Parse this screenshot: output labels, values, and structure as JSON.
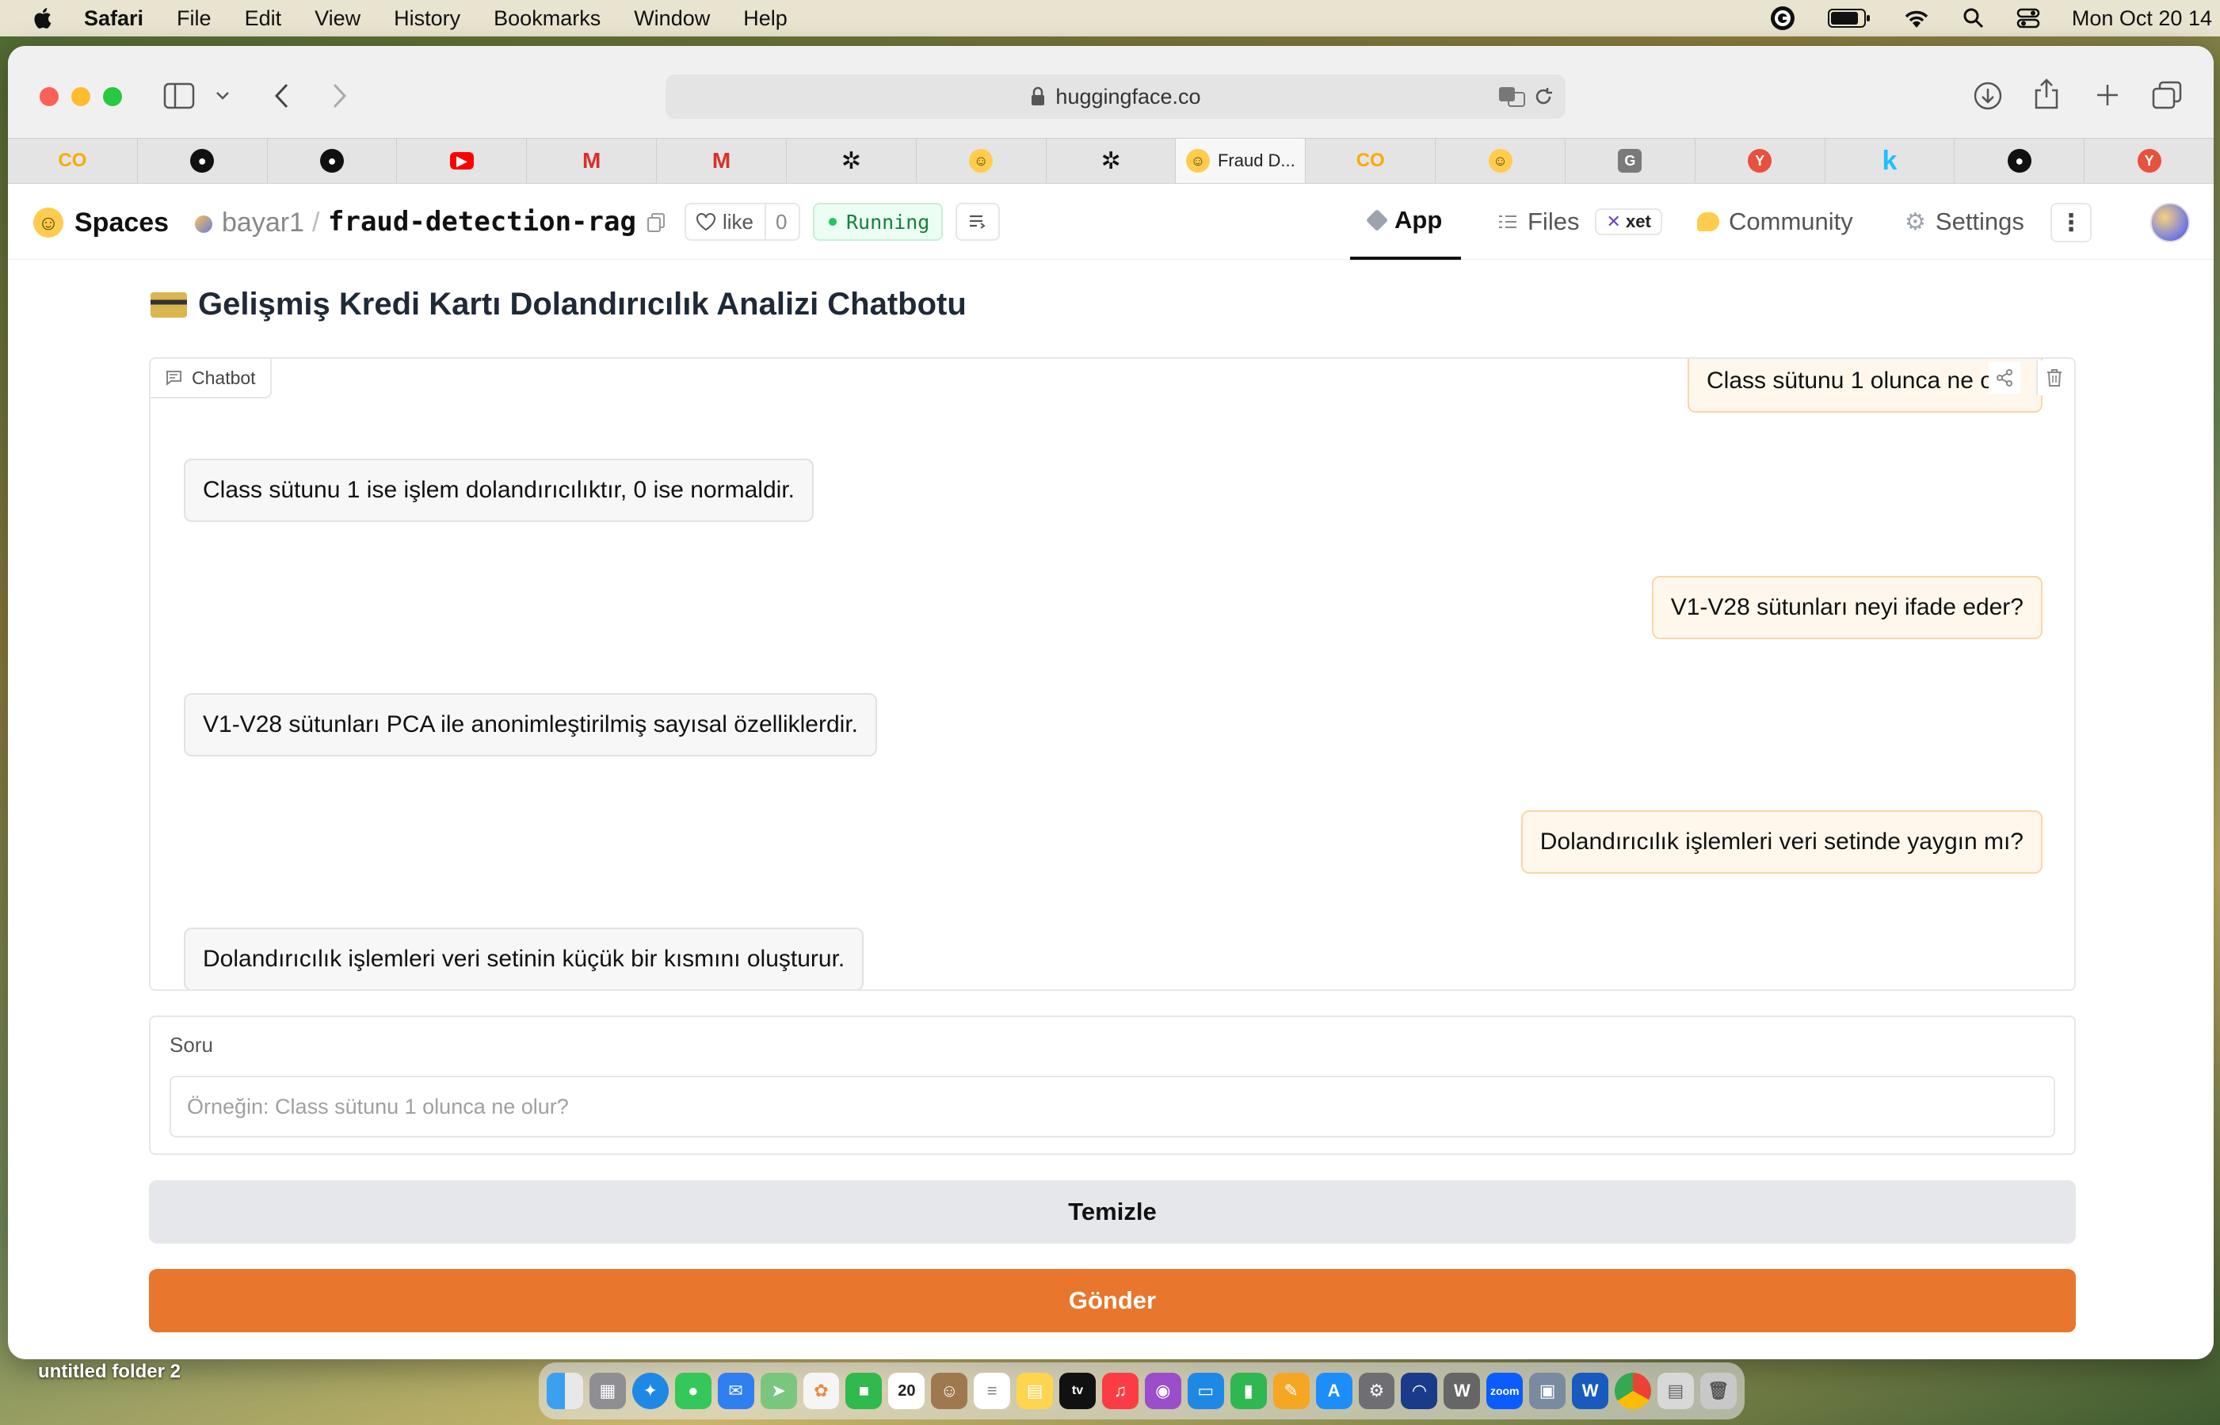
{
  "menubar": {
    "app": "Safari",
    "items": [
      "File",
      "Edit",
      "View",
      "History",
      "Bookmarks",
      "Window",
      "Help"
    ],
    "clock": "Mon Oct 20 14"
  },
  "browser": {
    "url": "huggingface.co",
    "tabs": [
      {
        "icon": "colab-icon",
        "label": "",
        "color": "#f9ab00"
      },
      {
        "icon": "github-icon",
        "label": "",
        "color": "#111111"
      },
      {
        "icon": "github-icon",
        "label": "",
        "color": "#111111"
      },
      {
        "icon": "youtube-icon",
        "label": "",
        "color": "#ff0000"
      },
      {
        "icon": "gmail-icon",
        "label": "",
        "color": "#d93025"
      },
      {
        "icon": "gmail-icon",
        "label": "",
        "color": "#d93025"
      },
      {
        "icon": "openai-icon",
        "label": "",
        "color": "#111111"
      },
      {
        "icon": "huggingface-icon",
        "label": "",
        "color": "#ffcc4d"
      },
      {
        "icon": "openai-icon",
        "label": "",
        "color": "#111111"
      },
      {
        "icon": "huggingface-icon",
        "label": "Fraud D...",
        "color": "#ffcc4d",
        "active": true
      },
      {
        "icon": "colab-icon",
        "label": "",
        "color": "#f9ab00"
      },
      {
        "icon": "huggingface-icon",
        "label": "",
        "color": "#ffcc4d"
      },
      {
        "icon": "g-icon",
        "label": "",
        "color": "#7a7a7a"
      },
      {
        "icon": "ycombinator-icon",
        "label": "",
        "color": "#e8513e"
      },
      {
        "icon": "kaggle-icon",
        "label": "",
        "color": "#20beff"
      },
      {
        "icon": "github-icon",
        "label": "",
        "color": "#111111"
      },
      {
        "icon": "ycombinator-icon",
        "label": "",
        "color": "#e8513e"
      }
    ]
  },
  "space": {
    "spaces_label": "Spaces",
    "owner": "bayar1",
    "name": "fraud-detection-rag",
    "like_label": "like",
    "like_count": "0",
    "status": "Running",
    "nav": {
      "app": "App",
      "files": "Files",
      "xet": "xet",
      "community": "Community",
      "settings": "Settings"
    }
  },
  "app": {
    "title_emoji": "💳",
    "title": "Gelişmiş Kredi Kartı Dolandırıcılık Analizi Chatbotu",
    "chatbot_label": "Chatbot",
    "messages": [
      {
        "role": "user",
        "text": "Class sütunu 1 olunca ne olu"
      },
      {
        "role": "bot",
        "text": "Class sütunu 1 ise işlem dolandırıcılıktır, 0 ise normaldir."
      },
      {
        "role": "user",
        "text": "V1-V28 sütunları neyi ifade eder?"
      },
      {
        "role": "bot",
        "text": "V1-V28 sütunları PCA ile anonimleştirilmiş sayısal özelliklerdir."
      },
      {
        "role": "user",
        "text": "Dolandırıcılık işlemleri veri setinde yaygın mı?"
      },
      {
        "role": "bot",
        "text": "Dolandırıcılık işlemleri veri setinin küçük bir kısmını oluşturur."
      }
    ],
    "question_label": "Soru",
    "question_placeholder": "Örneğin: Class sütunu 1 olunca ne olur?",
    "clear_button": "Temizle",
    "send_button": "Gönder"
  },
  "desktop": {
    "folder_label": "untitled folder 2"
  },
  "colors": {
    "accent": "#e8762c",
    "running": "#16a34a"
  }
}
